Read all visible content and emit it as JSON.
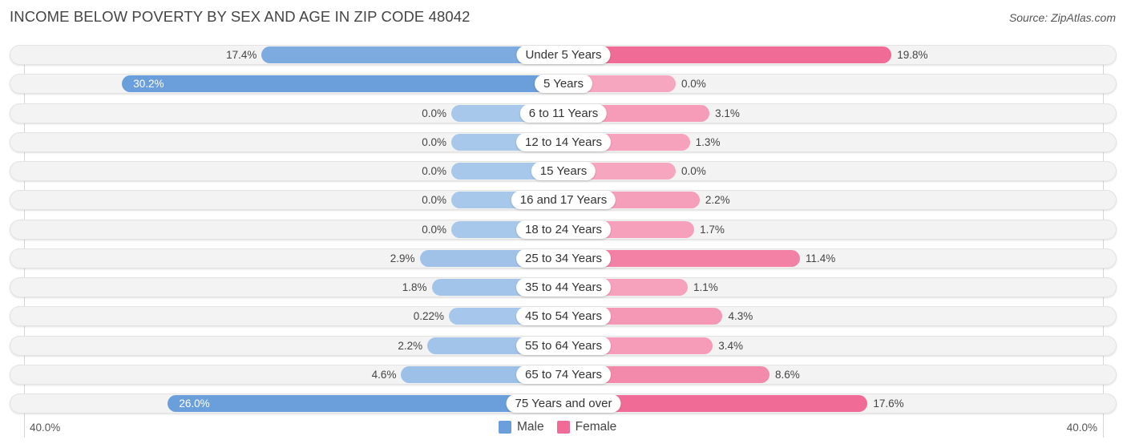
{
  "header": {
    "title": "INCOME BELOW POVERTY BY SEX AND AGE IN ZIP CODE 48042",
    "source": "Source: ZipAtlas.com"
  },
  "colors": {
    "male": "#6a9fdb",
    "male_light": "#a7c7eb",
    "female": "#f06b95",
    "female_light": "#f7a6c0"
  },
  "chart_data": {
    "type": "bar",
    "orientation": "horizontal-diverging",
    "title": "INCOME BELOW POVERTY BY SEX AND AGE IN ZIP CODE 48042",
    "categories": [
      "Under 5 Years",
      "5 Years",
      "6 to 11 Years",
      "12 to 14 Years",
      "15 Years",
      "16 and 17 Years",
      "18 to 24 Years",
      "25 to 34 Years",
      "35 to 44 Years",
      "45 to 54 Years",
      "55 to 64 Years",
      "65 to 74 Years",
      "75 Years and over"
    ],
    "series": [
      {
        "name": "Male",
        "values": [
          17.4,
          30.2,
          0.0,
          0.0,
          0.0,
          0.0,
          0.0,
          2.9,
          1.8,
          0.22,
          2.2,
          4.6,
          26.0
        ],
        "labels": [
          "17.4%",
          "30.2%",
          "0.0%",
          "0.0%",
          "0.0%",
          "0.0%",
          "0.0%",
          "2.9%",
          "1.8%",
          "0.22%",
          "2.2%",
          "4.6%",
          "26.0%"
        ]
      },
      {
        "name": "Female",
        "values": [
          19.8,
          0.0,
          3.1,
          1.3,
          0.0,
          2.2,
          1.7,
          11.4,
          1.1,
          4.3,
          3.4,
          8.6,
          17.6
        ],
        "labels": [
          "19.8%",
          "0.0%",
          "3.1%",
          "1.3%",
          "0.0%",
          "2.2%",
          "1.7%",
          "11.4%",
          "1.1%",
          "4.3%",
          "3.4%",
          "8.6%",
          "17.6%"
        ]
      }
    ],
    "xlim": [
      -40,
      40
    ],
    "axis_labels": {
      "left": "40.0%",
      "right": "40.0%"
    },
    "legend": {
      "position": "bottom-center",
      "entries": [
        "Male",
        "Female"
      ]
    },
    "xlabel": "",
    "ylabel": ""
  }
}
